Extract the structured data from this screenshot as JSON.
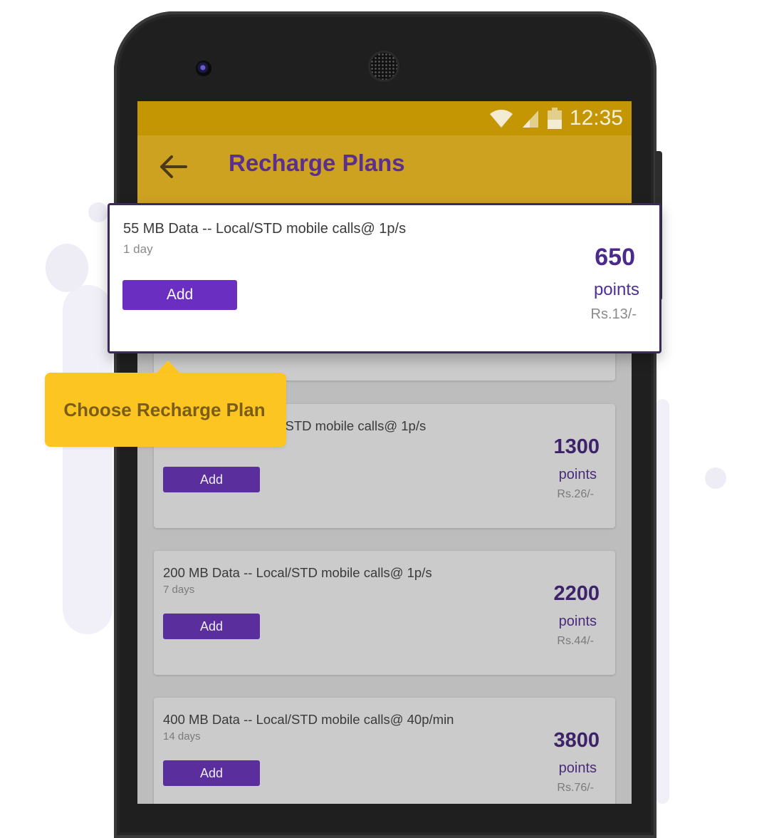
{
  "status_bar": {
    "time": "12:35"
  },
  "app_bar": {
    "title": "Recharge Plans"
  },
  "tooltip": {
    "text": "Choose Recharge Plan"
  },
  "highlighted_plan": {
    "description": "55 MB Data -- Local/STD mobile calls@ 1p/s",
    "validity": "1 day",
    "add_label": "Add",
    "points": "650",
    "points_label": "points",
    "price": "Rs.13/-"
  },
  "plans": [
    {
      "description": "al/STD mobile calls@ 1p/s",
      "validity": "",
      "add_label": "Add",
      "points": "1300",
      "points_label": "points",
      "price": "Rs.26/-"
    },
    {
      "description": "200 MB Data -- Local/STD mobile calls@ 1p/s",
      "validity": "7 days",
      "add_label": "Add",
      "points": "2200",
      "points_label": "points",
      "price": "Rs.44/-"
    },
    {
      "description": "400 MB Data -- Local/STD mobile calls@ 40p/min",
      "validity": "14 days",
      "add_label": "Add",
      "points": "3800",
      "points_label": "points",
      "price": "Rs.76/-"
    }
  ],
  "colors": {
    "app_bar": "#cea221",
    "status_bar": "#c49604",
    "accent_purple": "#5b2e9e",
    "tooltip": "#fcc521"
  }
}
